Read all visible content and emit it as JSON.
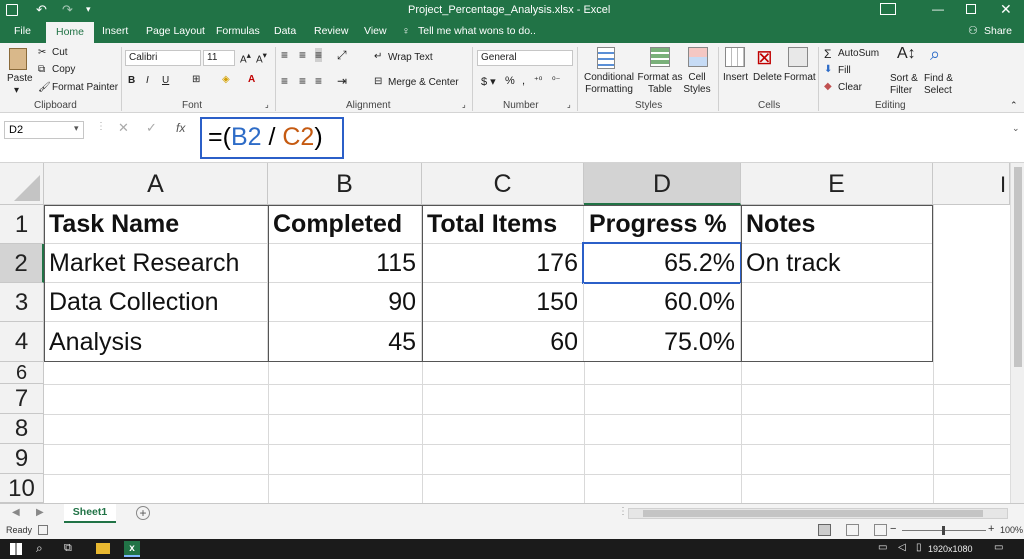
{
  "titlebar": {
    "title": "Project_Percentage_Analysis.xlsx  -  Excel",
    "search": "Tell me what wons to do..",
    "share": "Share"
  },
  "tabs": [
    "File",
    "Home",
    "Insert",
    "Page Layout",
    "Formulas",
    "Data",
    "Review",
    "View"
  ],
  "ribbon": {
    "paste": "Paste",
    "cut": "Cut",
    "copy": "Copy",
    "format_painter": "Format Painter",
    "font_name": "Calibri",
    "font_size": "11",
    "wrap_text": "Wrap Text",
    "merge_center": "Merge & Center",
    "number_format": "General",
    "conditional_formatting": "Conditional Formatting",
    "format_as_table": "Format as Table",
    "cell_styles": "Cell Styles",
    "insert": "Insert",
    "delete": "Delete",
    "format": "Format",
    "autosum": "AutoSum",
    "fill": "Fill",
    "clear": "Clear",
    "sort_filter": "Sort & Filter",
    "find_select": "Find & Select",
    "groups": [
      "Clipboard",
      "Font",
      "Alignment",
      "Number",
      "Styles",
      "Cells",
      "Editing"
    ]
  },
  "formula_bar": {
    "name_box": "D2",
    "fx": "fx",
    "formula_prefix": "=(",
    "ref1": "B2",
    "op": " / ",
    "ref2": "C2",
    "formula_suffix": ")"
  },
  "grid": {
    "columns": [
      "A",
      "B",
      "C",
      "D",
      "E"
    ],
    "rows": [
      "1",
      "2",
      "3",
      "4",
      "6",
      "7",
      "8",
      "9",
      "10"
    ],
    "header": [
      "Task Name",
      "Completed",
      "Total Items",
      "Progress %",
      "Notes"
    ],
    "data": [
      [
        "Market Research",
        "115",
        "176",
        "65.2%",
        "On track"
      ],
      [
        "Data Collection",
        "90",
        "150",
        "60.0%",
        ""
      ],
      [
        "Analysis",
        "45",
        "60",
        "75.0%",
        ""
      ]
    ]
  },
  "sheet_tab": "Sheet1",
  "status": {
    "ready": "Ready",
    "zoom": "100%",
    "resolution": "1920x1080"
  },
  "colors": {
    "excel_green": "#217346",
    "ref_blue": "#2e6cc7",
    "ref_orange": "#c55a11",
    "selection": "#2b5fc8"
  }
}
